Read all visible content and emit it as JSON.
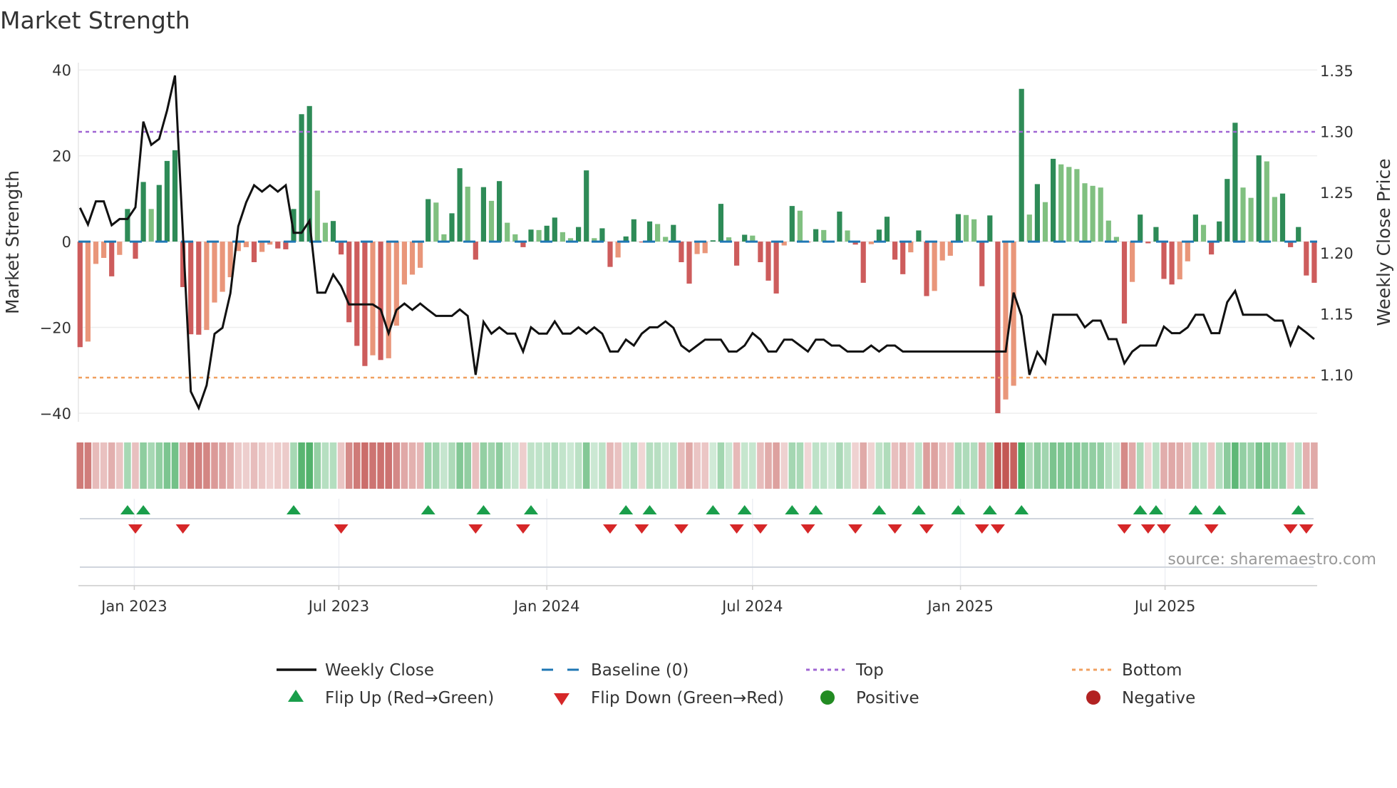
{
  "title": "Market Strength",
  "source": "source: sharemaestro.com",
  "colors": {
    "bar_pos_strong": "#2e8b57",
    "bar_pos_weak": "#80c080",
    "bar_neg_strong": "#cd5c5c",
    "bar_neg_weak": "#e9967a",
    "baseline": "#1f77b4",
    "top": "#a066d3",
    "bottom": "#f0a060",
    "close": "#111111",
    "flip_up": "#1a9e4b",
    "flip_down": "#d62728",
    "positive": "#228b22",
    "negative": "#b22222",
    "strip_pos": "#3aa757",
    "strip_neg": "#c0504d"
  },
  "legend": [
    {
      "label": "Weekly Close",
      "symbol": "line"
    },
    {
      "label": "Baseline (0)",
      "symbol": "dash"
    },
    {
      "label": "Top",
      "symbol": "dot-purple"
    },
    {
      "label": "Bottom",
      "symbol": "dot-orange"
    },
    {
      "label": "Flip Up (Red→Green)",
      "symbol": "triangle-up"
    },
    {
      "label": "Flip Down (Green→Red)",
      "symbol": "triangle-down"
    },
    {
      "label": "Positive",
      "symbol": "circle-green"
    },
    {
      "label": "Negative",
      "symbol": "circle-red"
    }
  ],
  "chart_data": {
    "type": "bar",
    "title": "Market Strength",
    "ylabel": "Market Strength",
    "y2label": "Weekly Close Price",
    "xlabel": "",
    "x_start_week": "2022-11-14",
    "x_interval_days": 7,
    "ylim": [
      -42,
      41.7
    ],
    "y2lim": [
      1.0614,
      1.3564
    ],
    "yticks": [
      40,
      20,
      0,
      -20,
      -40
    ],
    "ytick_labels": [
      "40",
      "20",
      "0",
      "−20",
      "−40"
    ],
    "y2ticks": [
      1.35,
      1.3,
      1.25,
      1.2,
      1.15,
      1.1
    ],
    "y2tick_labels": [
      "1.35",
      "1.30",
      "1.25",
      "1.20",
      "1.15",
      "1.10"
    ],
    "xticks": [
      {
        "date": "2023-01-01",
        "label": "Jan 2023"
      },
      {
        "date": "2023-07-01",
        "label": "Jul 2023"
      },
      {
        "date": "2024-01-01",
        "label": "Jan 2024"
      },
      {
        "date": "2024-07-01",
        "label": "Jul 2024"
      },
      {
        "date": "2025-01-01",
        "label": "Jan 2025"
      },
      {
        "date": "2025-07-01",
        "label": "Jul 2025"
      }
    ],
    "grid": true,
    "legend_position": "bottom",
    "top_level": 25.6,
    "bottom_level": -31.7,
    "baseline": 0,
    "series": [
      {
        "name": "Market Strength",
        "type": "bar",
        "values": [
          -24.6,
          -23.3,
          -5.2,
          -3.8,
          -8.1,
          -3.1,
          7.6,
          -4,
          13.9,
          7.6,
          13.2,
          18.8,
          21.3,
          -10.6,
          -21.6,
          -21.7,
          -20.6,
          -14.2,
          -11.7,
          -8.3,
          -2.2,
          -1.3,
          -4.8,
          -2.4,
          -0.7,
          -1.6,
          -1.8,
          7.6,
          29.7,
          31.6,
          11.9,
          4.4,
          4.8,
          -3,
          -18.8,
          -24.3,
          -29,
          -26.5,
          -27.6,
          -27.2,
          -19.6,
          -10,
          -7.7,
          -6.1,
          9.9,
          9.1,
          1.7,
          6.6,
          17.1,
          12.8,
          -4.2,
          12.7,
          9.5,
          14.1,
          4.4,
          1.7,
          -1.3,
          2.8,
          2.7,
          3.7,
          5.6,
          2.2,
          0.8,
          3.4,
          16.6,
          0.8,
          3.1,
          -5.9,
          -3.7,
          1.2,
          5.2,
          -0.2,
          4.7,
          4.1,
          1.1,
          3.9,
          -4.8,
          -9.8,
          -2.9,
          -2.7,
          0.3,
          8.8,
          1.0,
          -5.6,
          1.6,
          1.4,
          -4.8,
          -9.1,
          -12.1,
          -0.9,
          8.3,
          7.2,
          -0.2,
          2.9,
          2.7,
          0.2,
          7.0,
          2.6,
          -0.7,
          -9.6,
          -0.6,
          2.8,
          5.8,
          -4.2,
          -7.6,
          -2.5,
          2.6,
          -12.7,
          -11.5,
          -4.4,
          -3.3,
          6.4,
          6.2,
          5.2,
          -10.4,
          6.1,
          -40,
          -36.8,
          -33.6,
          35.6,
          6.3,
          13.4,
          9.2,
          19.3,
          18,
          17.4,
          16.9,
          13.6,
          13,
          12.6,
          4.9,
          1.1,
          -19.1,
          -9.4,
          6.3,
          -0.4,
          3.4,
          -8.7,
          -10,
          -8.8,
          -4.6,
          6.3,
          3.9,
          -3,
          4.7,
          14.6,
          27.7,
          12.6,
          10.2,
          20.1,
          18.7,
          10.4,
          11.2,
          -1.3,
          3.4,
          -7.9,
          -9.6
        ]
      },
      {
        "name": "Weekly Close",
        "type": "line",
        "axis": "right",
        "values": [
          1.2372,
          1.2235,
          1.2425,
          1.2425,
          1.2229,
          1.228,
          1.228,
          1.2376,
          1.308,
          1.2889,
          1.2938,
          1.3172,
          1.3459,
          1.2161,
          1.0863,
          1.0727,
          1.0914,
          1.1336,
          1.1386,
          1.1669,
          1.222,
          1.2417,
          1.2557,
          1.2505,
          1.2557,
          1.2505,
          1.2557,
          1.2167,
          1.2167,
          1.2265,
          1.1675,
          1.1675,
          1.1824,
          1.1728,
          1.1578,
          1.1578,
          1.1578,
          1.1578,
          1.1537,
          1.1341,
          1.1533,
          1.1585,
          1.1533,
          1.1585,
          1.1533,
          1.1484,
          1.1484,
          1.1484,
          1.1537,
          1.1484,
          1.1,
          1.1435,
          1.1338,
          1.139,
          1.1338,
          1.1338,
          1.1191,
          1.139,
          1.1338,
          1.1338,
          1.1439,
          1.1338,
          1.1338,
          1.139,
          1.1338,
          1.139,
          1.1338,
          1.1191,
          1.1191,
          1.1289,
          1.124,
          1.1338,
          1.139,
          1.139,
          1.1439,
          1.1386,
          1.124,
          1.1191,
          1.124,
          1.1289,
          1.1289,
          1.1289,
          1.1191,
          1.1191,
          1.124,
          1.1342,
          1.1289,
          1.1191,
          1.1191,
          1.1289,
          1.1289,
          1.124,
          1.1191,
          1.1289,
          1.1289,
          1.124,
          1.124,
          1.1191,
          1.1191,
          1.1191,
          1.124,
          1.1191,
          1.124,
          1.124,
          1.1191,
          1.1191,
          1.1191,
          1.1191,
          1.1191,
          1.1191,
          1.1191,
          1.1191,
          1.1191,
          1.1191,
          1.1191,
          1.1191,
          1.1191,
          1.1191,
          1.1675,
          1.1484,
          1.1,
          1.1187,
          1.1094,
          1.1494,
          1.1494,
          1.1494,
          1.1494,
          1.139,
          1.1445,
          1.1445,
          1.1293,
          1.1293,
          1.1094,
          1.1191,
          1.124,
          1.124,
          1.124,
          1.1396,
          1.1342,
          1.1342,
          1.139,
          1.1494,
          1.1494,
          1.1342,
          1.1342,
          1.1597,
          1.1689,
          1.1494,
          1.1494,
          1.1494,
          1.1494,
          1.1445,
          1.1445,
          1.1244,
          1.1396,
          1.1347,
          1.1293
        ]
      }
    ]
  }
}
